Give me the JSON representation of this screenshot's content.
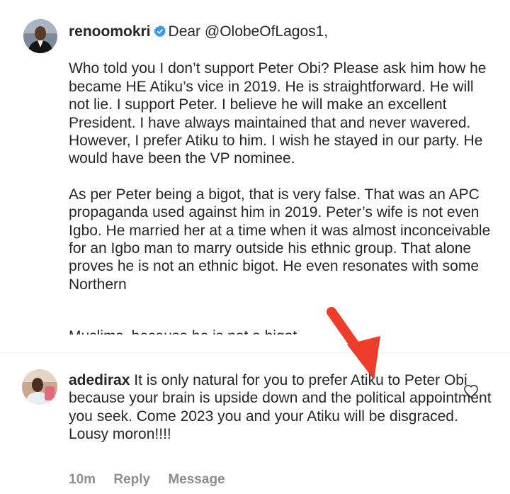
{
  "post": {
    "username": "renoomokri",
    "greeting": "Dear @OlobeOfLagos1,",
    "paragraph1": "Who told you I don’t support Peter Obi? Please ask him how he became HE Atiku’s vice in 2019. He is straightforward. He will not lie. I support Peter. I believe he will make an excellent President. I have always maintained that and never wavered. However, I prefer Atiku to him. I wish he stayed in our party. He would have been the VP nominee.",
    "paragraph2": "As per Peter being a bigot, that is very false. That was an APC propaganda used against him in 2019. Peter’s wife is not even Igbo. He married her at a time when it was almost inconceivable for an Igbo man to marry outside his ethnic group. That alone proves he is not an ethnic bigot. He even resonates with some Northern",
    "cut_line": "Muslims, because he is not a bigot"
  },
  "reply": {
    "username": "adedirax",
    "text": "It is only natural for you to prefer Atiku to Peter Obi because your brain is upside down and the political appointment you seek. Come 2023 you and your Atiku will be disgraced. Lousy moron!!!!",
    "time": "10m",
    "reply_label": "Reply",
    "message_label": "Message"
  },
  "icons": {
    "verified": "verified-badge-icon",
    "like": "heart-icon",
    "annotation": "red-arrow-icon"
  },
  "colors": {
    "verified_blue": "#3897f0",
    "arrow_red": "#f03c2a",
    "meta_gray": "#8e8e8e"
  }
}
